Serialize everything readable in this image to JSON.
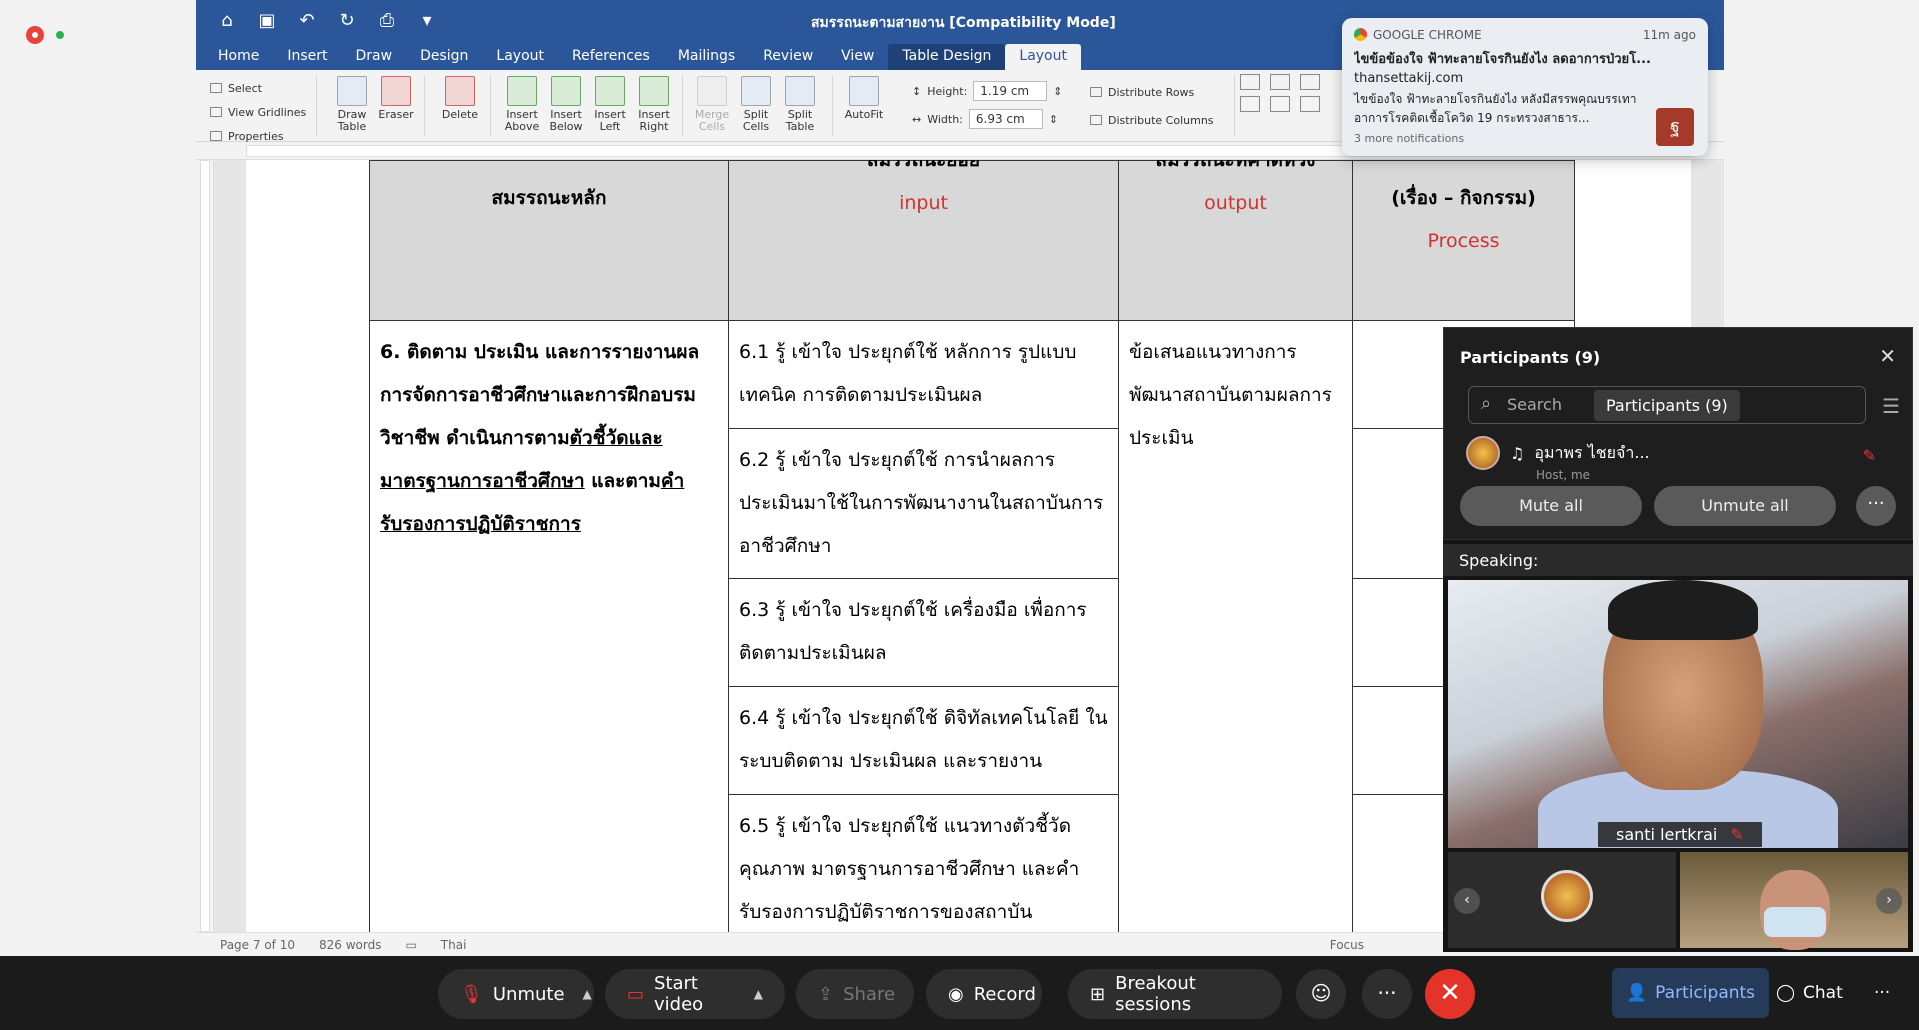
{
  "word": {
    "doc_title": "สมรรถนะตามสายงาน [Compatibility Mode]",
    "tabs": [
      "Home",
      "Insert",
      "Draw",
      "Design",
      "Layout",
      "References",
      "Mailings",
      "Review",
      "View",
      "Table Design",
      "Layout"
    ],
    "ribbon": {
      "select": "Select",
      "view_gridlines": "View Gridlines",
      "properties": "Properties",
      "draw_table": "Draw Table",
      "eraser": "Eraser",
      "delete": "Delete",
      "insert_above": "Insert Above",
      "insert_below": "Insert Below",
      "insert_left": "Insert Left",
      "insert_right": "Insert Right",
      "merge_cells": "Merge Cells",
      "split_cells": "Split Cells",
      "split_table": "Split Table",
      "autofit": "AutoFit",
      "height_label": "Height:",
      "height_value": "1.19 cm",
      "width_label": "Width:",
      "width_value": "6.93 cm",
      "distribute_rows": "Distribute Rows",
      "distribute_columns": "Distribute Columns"
    },
    "table": {
      "headers": {
        "col1": "สมรรถนะหลัก",
        "col2": "สมรรถนะย่อย",
        "col2_sub": "input",
        "col3": "สมรรถนะที่คาดหวัง",
        "col3_sub": "output",
        "col4": "(เรื่อง – กิจกรรม)",
        "col4_sub": "Process"
      },
      "main_comp": {
        "part1": "6. ติดตาม ประเมิน และการรายงานผลการจัดการอาชีวศึกษาและการฝึกอบรมวิชาชีพ ดำเนินการตาม",
        "link1": "ตัวชี้วัดและมาตรฐานการอาชีวศึกษา",
        "part2": " และตาม",
        "link2": "คำรับรองการปฏิบัติราชการ"
      },
      "sub_items": [
        "6.1 รู้ เข้าใจ ประยุกต์ใช้ หลักการ รูปแบบ เทคนิค การติดตามประเมินผล",
        "6.2 รู้ เข้าใจ ประยุกต์ใช้ การนำผลการประเมินมาใช้ในการพัฒนางานในสถาบันการอาชีวศึกษา",
        "6.3 รู้ เข้าใจ ประยุกต์ใช้ เครื่องมือ เพื่อการติดตามประเมินผล",
        "6.4 รู้ เข้าใจ ประยุกต์ใช้ ดิจิทัลเทคโนโลยี ในระบบติดตาม ประเมินผล และรายงาน",
        "6.5 รู้ เข้าใจ ประยุกต์ใช้ แนวทางตัวชี้วัดคุณภาพ มาตรฐานการอาชีวศึกษา และคำรับรองการปฏิบัติราชการของสถาบัน"
      ],
      "output_text": "ข้อเสนอแนวทางการพัฒนาสถาบันตามผลการประเมิน"
    },
    "status": {
      "page": "Page 7 of 10",
      "words": "826 words",
      "language": "Thai",
      "focus": "Focus"
    }
  },
  "notification": {
    "app": "GOOGLE CHROME",
    "time": "11m ago",
    "title": "ไขข้อข้องใจ ฟ้าทะลายโจรกินยังไง ลดอาการป่วยโ...",
    "site": "thansettakij.com",
    "body": "ไขข้องใจ ฟ้าทะลายโจรกินยังไง หลังมีสรรพคุณบรรเทาอาการโรคติดเชื้อโควิด 19 กระทรวงสาธาร...",
    "more": "3 more notifications"
  },
  "participants": {
    "title": "Participants (9)",
    "search_placeholder": "Search",
    "tooltip": "Participants (9)",
    "member_name": "อุมาพร ไชยจำ...",
    "member_role": "Host, me",
    "mute_all": "Mute all",
    "unmute_all": "Unmute all"
  },
  "speaking": {
    "label": "Speaking:",
    "speaker_name": "santi lertkrai"
  },
  "toolbar": {
    "unmute": "Unmute",
    "start_video": "Start video",
    "share": "Share",
    "record": "Record",
    "breakout": "Breakout sessions",
    "participants": "Participants",
    "chat": "Chat"
  }
}
